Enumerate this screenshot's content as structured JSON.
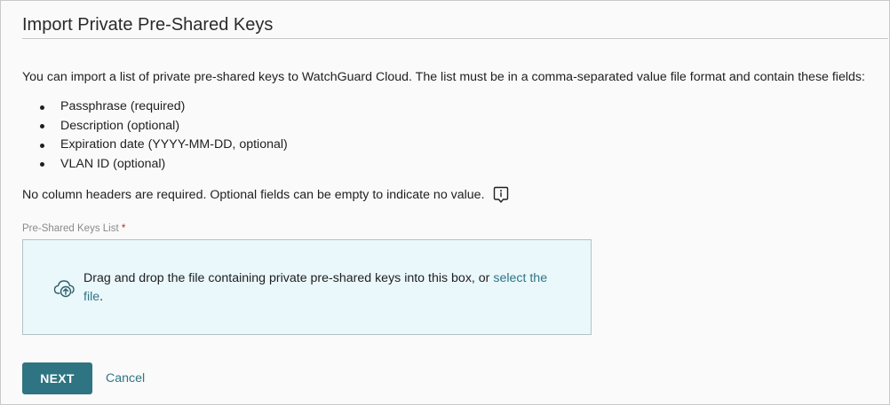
{
  "header": {
    "title": "Import Private Pre-Shared Keys"
  },
  "intro": {
    "text": "You can import a list of private pre-shared keys to WatchGuard Cloud. The list must be in a comma-separated value file format and contain these fields:"
  },
  "fields": [
    {
      "label": "Passphrase (required)"
    },
    {
      "label": "Description (optional)"
    },
    {
      "label": "Expiration date (YYYY-MM-DD, optional)"
    },
    {
      "label": "VLAN ID (optional)"
    }
  ],
  "note": {
    "text": "No column headers are required. Optional fields can be empty to indicate no value.",
    "icon": "info-icon"
  },
  "upload": {
    "label": "Pre-Shared Keys List",
    "required_marker": "*",
    "icon": "cloud-upload-icon",
    "drop_text": "Drag and drop the file containing private pre-shared keys into this box, or ",
    "link_text": "select the file",
    "trailing": "."
  },
  "actions": {
    "next_label": "NEXT",
    "cancel_label": "Cancel"
  },
  "colors": {
    "primary": "#2f7482",
    "link": "#2f7685",
    "dropzone_bg": "#eaf7fb",
    "required": "#c62828"
  }
}
